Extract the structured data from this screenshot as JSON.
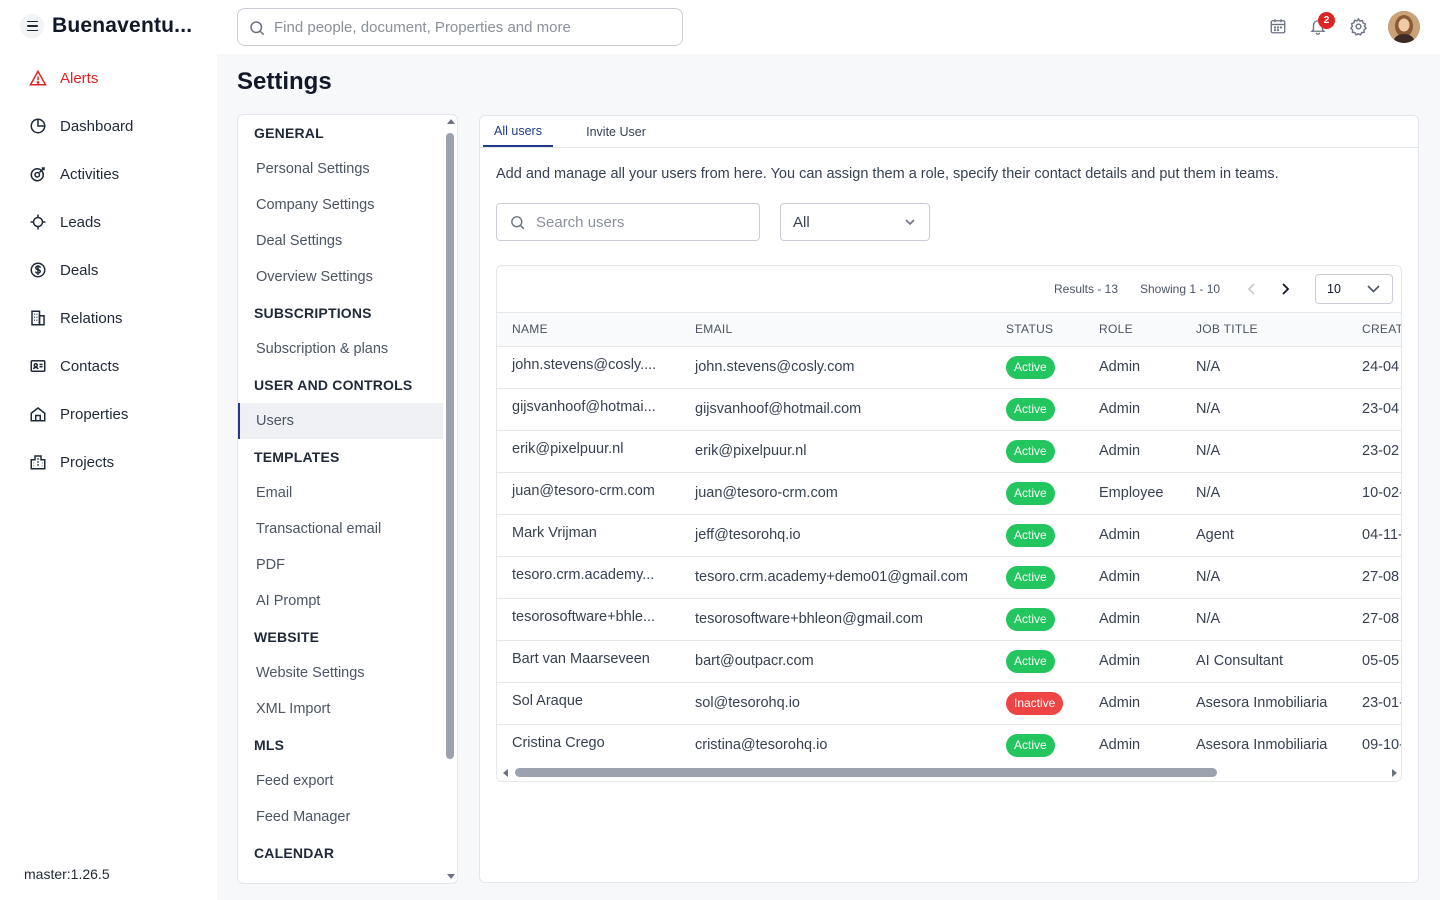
{
  "app": {
    "brand": "Buenaventu...",
    "search_placeholder": "Find people, document, Properties and more",
    "notification_count": "2",
    "version": "master:1.26.5"
  },
  "sidebar": {
    "items": [
      {
        "label": "Alerts",
        "icon": "alert-triangle-icon"
      },
      {
        "label": "Dashboard",
        "icon": "pie-chart-icon"
      },
      {
        "label": "Activities",
        "icon": "activity-icon"
      },
      {
        "label": "Leads",
        "icon": "leads-icon"
      },
      {
        "label": "Deals",
        "icon": "dollar-circle-icon"
      },
      {
        "label": "Relations",
        "icon": "building-icon"
      },
      {
        "label": "Contacts",
        "icon": "contact-card-icon"
      },
      {
        "label": "Properties",
        "icon": "home-icon"
      },
      {
        "label": "Projects",
        "icon": "city-icon"
      }
    ]
  },
  "page": {
    "title": "Settings"
  },
  "settings_nav": {
    "sections": [
      {
        "heading": "GENERAL",
        "items": [
          "Personal Settings",
          "Company Settings",
          "Deal Settings",
          "Overview Settings"
        ]
      },
      {
        "heading": "SUBSCRIPTIONS",
        "items": [
          "Subscription & plans"
        ]
      },
      {
        "heading": "USER AND CONTROLS",
        "items": [
          "Users"
        ]
      },
      {
        "heading": "TEMPLATES",
        "items": [
          "Email",
          "Transactional email",
          "PDF",
          "AI Prompt"
        ]
      },
      {
        "heading": "WEBSITE",
        "items": [
          "Website Settings",
          "XML Import"
        ]
      },
      {
        "heading": "MLS",
        "items": [
          "Feed export",
          "Feed Manager"
        ]
      },
      {
        "heading": "CALENDAR",
        "items": []
      }
    ],
    "active_item": "Users"
  },
  "users": {
    "tabs": [
      "All users",
      "Invite User"
    ],
    "description": "Add and manage all your users from here. You can assign them a role, specify their contact details and put them in teams.",
    "search_placeholder": "Search users",
    "filter_value": "All",
    "results": "Results - 13",
    "showing": "Showing 1 - 10",
    "per_page": "10",
    "columns": [
      "NAME",
      "EMAIL",
      "STATUS",
      "ROLE",
      "JOB TITLE",
      "CREATED"
    ],
    "rows": [
      {
        "name": "john.stevens@cosly....",
        "email": "john.stevens@cosly.com",
        "status": "Active",
        "role": "Admin",
        "job_title": "N/A",
        "created": "24-04"
      },
      {
        "name": "gijsvanhoof@hotmai...",
        "email": "gijsvanhoof@hotmail.com",
        "status": "Active",
        "role": "Admin",
        "job_title": "N/A",
        "created": "23-04"
      },
      {
        "name": "erik@pixelpuur.nl",
        "email": "erik@pixelpuur.nl",
        "status": "Active",
        "role": "Admin",
        "job_title": "N/A",
        "created": "23-02"
      },
      {
        "name": "juan@tesoro-crm.com",
        "email": "juan@tesoro-crm.com",
        "status": "Active",
        "role": "Employee",
        "job_title": "N/A",
        "created": "10-02-"
      },
      {
        "name": "Mark Vrijman",
        "email": "jeff@tesorohq.io",
        "status": "Active",
        "role": "Admin",
        "job_title": "Agent",
        "created": "04-11-"
      },
      {
        "name": "tesoro.crm.academy...",
        "email": "tesoro.crm.academy+demo01@gmail.com",
        "status": "Active",
        "role": "Admin",
        "job_title": "N/A",
        "created": "27-08"
      },
      {
        "name": "tesorosoftware+bhle...",
        "email": "tesorosoftware+bhleon@gmail.com",
        "status": "Active",
        "role": "Admin",
        "job_title": "N/A",
        "created": "27-08"
      },
      {
        "name": "Bart van Maarseveen",
        "email": "bart@outpacr.com",
        "status": "Active",
        "role": "Admin",
        "job_title": "AI Consultant",
        "created": "05-05"
      },
      {
        "name": "Sol Araque",
        "email": "sol@tesorohq.io",
        "status": "Inactive",
        "role": "Admin",
        "job_title": "Asesora Inmobiliaria",
        "created": "23-01-"
      },
      {
        "name": "Cristina Crego",
        "email": "cristina@tesorohq.io",
        "status": "Active",
        "role": "Admin",
        "job_title": "Asesora Inmobiliaria",
        "created": "09-10-"
      }
    ]
  },
  "colors": {
    "accent": "#1f3b8a",
    "alert": "#dc2626",
    "active_badge": "#22c55e",
    "inactive_badge": "#ef4444"
  }
}
